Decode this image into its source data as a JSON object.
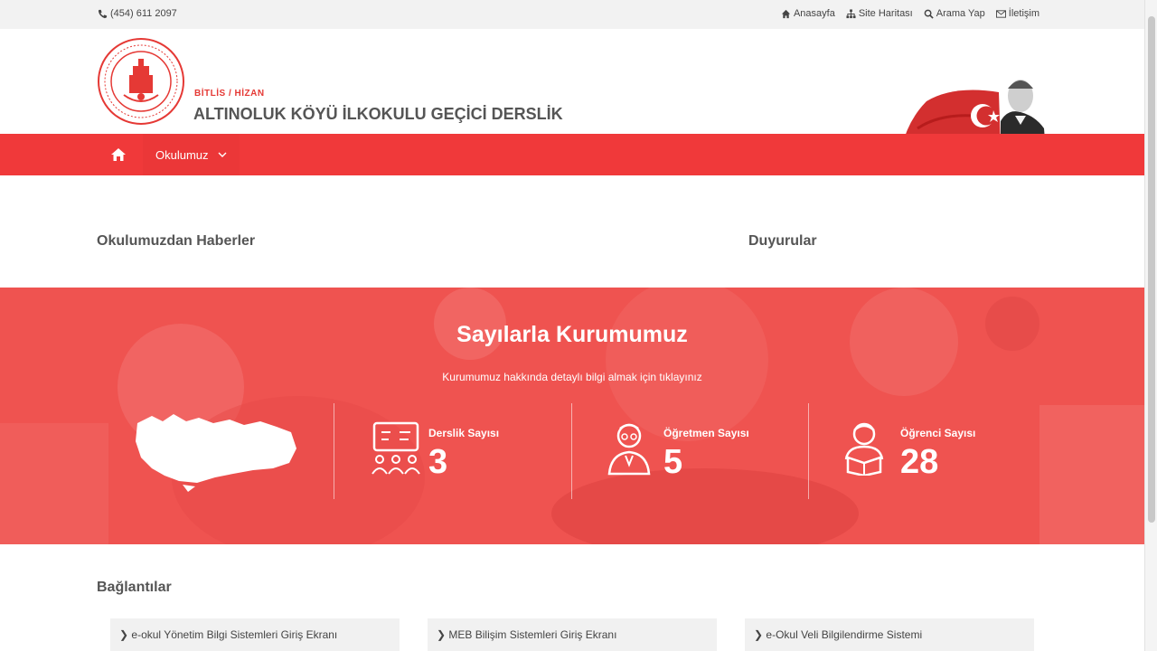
{
  "topbar": {
    "phone": "(454) 611 2097",
    "links": [
      "Anasayfa",
      "Site Haritası",
      "Arama Yap",
      "İletişim"
    ]
  },
  "header": {
    "location": "BİTLİS / HİZAN",
    "school_name": "ALTINOLUK KÖYÜ İLKOKULU GEÇİCİ DERSLİK"
  },
  "nav": {
    "items": [
      "Okulumuz"
    ]
  },
  "sections": {
    "news_title": "Okulumuzdan Haberler",
    "announcements_title": "Duyurular"
  },
  "stats": {
    "title": "Sayılarla Kurumumuz",
    "subtitle": "Kurumumuz hakkında detaylı bilgi almak için tıklayınız",
    "items": [
      {
        "label": "Derslik Sayısı",
        "value": "3"
      },
      {
        "label": "Öğretmen Sayısı",
        "value": "5"
      },
      {
        "label": "Öğrenci Sayısı",
        "value": "28"
      }
    ]
  },
  "links_section": {
    "title": "Bağlantılar",
    "items": [
      "e-okul Yönetim Bilgi Sistemleri Giriş Ekranı",
      "MEB Bilişim Sistemleri Giriş Ekranı",
      "e-Okul Veli Bilgilendirme Sistemi"
    ]
  },
  "colors": {
    "brand_red": "#f0393a",
    "stats_red": "#ef5350",
    "title_gray": "#555555"
  },
  "icons": [
    "phone-icon",
    "home-icon",
    "sitemap-icon",
    "search-icon",
    "envelope-icon",
    "chevron-down-icon",
    "classroom-icon",
    "teacher-icon",
    "student-icon",
    "turkey-map"
  ]
}
